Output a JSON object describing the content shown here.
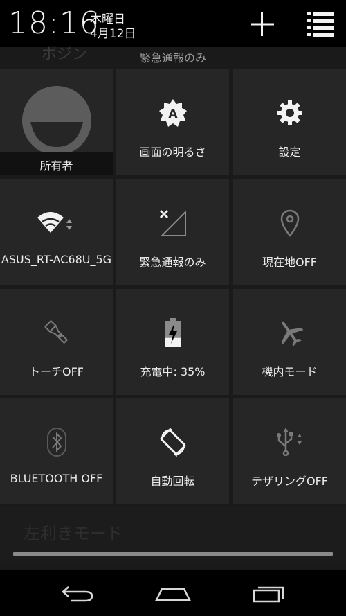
{
  "status": {
    "time": "18:16",
    "day_of_week": "木曜日",
    "date": "4月12日"
  },
  "header": {
    "emergency_text": "緊急通報のみ",
    "ghost_top": "ポジン",
    "add_icon": "plus-icon",
    "list_icon": "notification-list-icon"
  },
  "tiles": {
    "owner": {
      "label": "所有者",
      "icon": "avatar-icon"
    },
    "brightness": {
      "label": "画面の明るさ",
      "icon": "brightness-auto-icon"
    },
    "settings": {
      "label": "設定",
      "icon": "gear-icon"
    },
    "wifi": {
      "label": "ASUS_RT-AC68U_5G",
      "icon": "wifi-icon"
    },
    "mobile": {
      "label": "緊急通報のみ",
      "icon": "no-signal-icon"
    },
    "location": {
      "label": "現在地OFF",
      "icon": "location-pin-icon"
    },
    "torch": {
      "label": "トーチOFF",
      "icon": "flashlight-icon"
    },
    "battery": {
      "label": "充電中: 35%",
      "icon": "battery-charging-icon",
      "level": 0.35
    },
    "airplane": {
      "label": "機内モード",
      "icon": "airplane-icon"
    },
    "bluetooth": {
      "label": "BLUETOOTH OFF",
      "icon": "bluetooth-icon"
    },
    "rotate": {
      "label": "自動回転",
      "icon": "auto-rotate-icon"
    },
    "tethering": {
      "label": "テザリングOFF",
      "icon": "usb-icon"
    }
  },
  "ghost_bottom": "左利きモード",
  "nav": {
    "back_icon": "back-icon",
    "home_icon": "home-icon",
    "recents_icon": "recents-icon"
  },
  "colors": {
    "background": "#000000",
    "tile": "#262626",
    "text": "#ececec",
    "dim_icon": "#7a7a7a"
  }
}
